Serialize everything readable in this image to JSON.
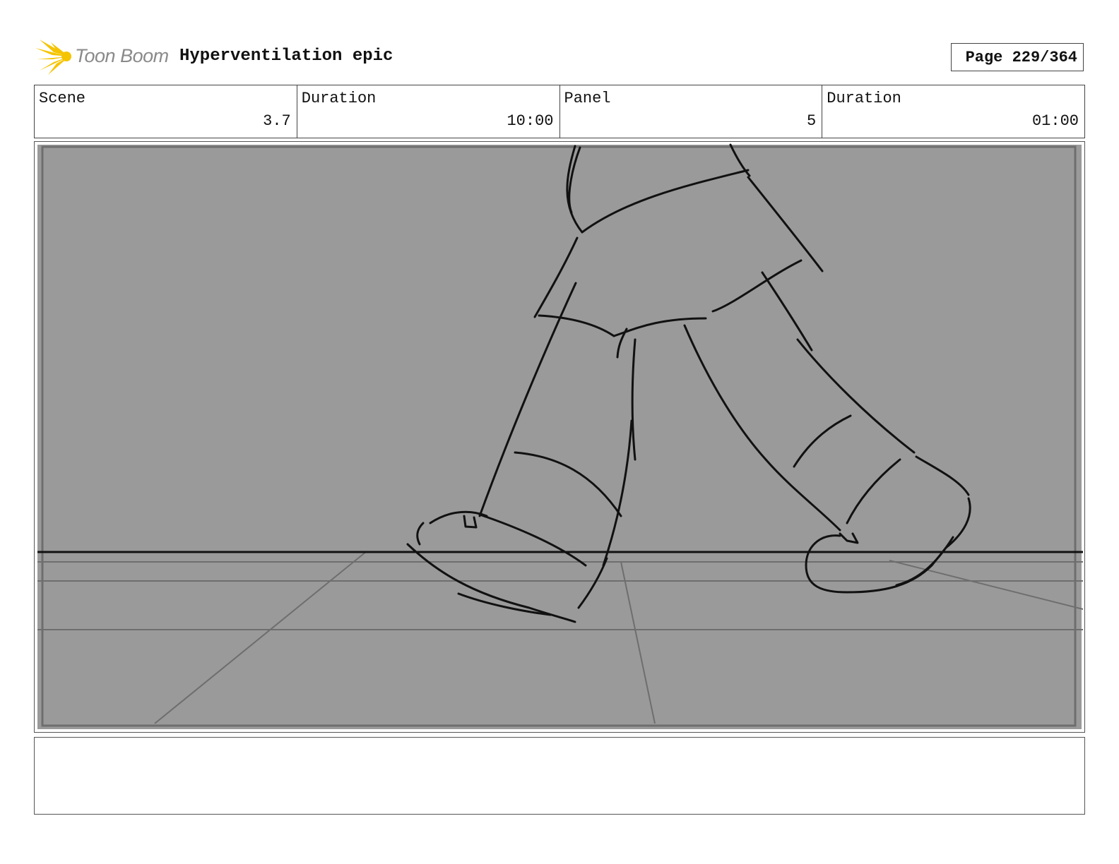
{
  "header": {
    "logo_text": "Toon Boom",
    "title": "Hyperventilation epic",
    "page_label": "Page 229/364"
  },
  "info": {
    "scene_label": "Scene",
    "scene_value": "3.7",
    "scene_duration_label": "Duration",
    "scene_duration_value": "10:00",
    "panel_label": "Panel",
    "panel_value": "5",
    "panel_duration_label": "Duration",
    "panel_duration_value": "01:00"
  },
  "panel": {
    "background_color": "#9a9a9a",
    "line_color": "#111111",
    "guide_color": "#6e6e6e"
  },
  "notes": {
    "text": ""
  }
}
